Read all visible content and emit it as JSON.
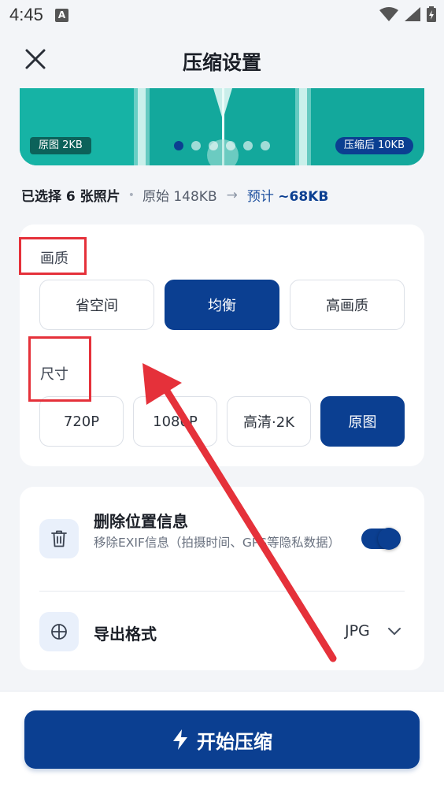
{
  "status_bar": {
    "time": "4:45",
    "app_icon_letter": "A",
    "icons": [
      "wifi-icon",
      "signal-icon",
      "battery-icon"
    ]
  },
  "header": {
    "title": "压缩设置",
    "close_icon": "close-icon"
  },
  "preview": {
    "original_badge": "原图 2KB",
    "compressed_badge": "压缩后 10KB",
    "slide_count": 6,
    "active_slide": 1
  },
  "summary": {
    "selected_prefix": "已选择 ",
    "selected_count": "6",
    "selected_suffix": " 张照片",
    "original": "原始 148KB",
    "arrow": "→",
    "estimate_label": "预计 ",
    "estimate_value": "~68KB"
  },
  "quality": {
    "label": "画质",
    "options": [
      "省空间",
      "均衡",
      "高画质"
    ],
    "selected": "均衡"
  },
  "size": {
    "label": "尺寸",
    "options": [
      "720P",
      "1080P",
      "高清·2K",
      "原图"
    ],
    "selected": "原图"
  },
  "location": {
    "title": "删除位置信息",
    "description": "移除EXIF信息（拍摄时间、GPS等隐私数据）",
    "enabled": true,
    "icon": "trash-icon"
  },
  "export": {
    "label": "导出格式",
    "value": "JPG",
    "icon": "crosshair-icon"
  },
  "start_button": {
    "label": "开始压缩",
    "icon": "lightning-icon"
  },
  "colors": {
    "primary": "#0b3f91",
    "annotation_red": "#e5313a",
    "preview_teal": "#12a59a"
  }
}
